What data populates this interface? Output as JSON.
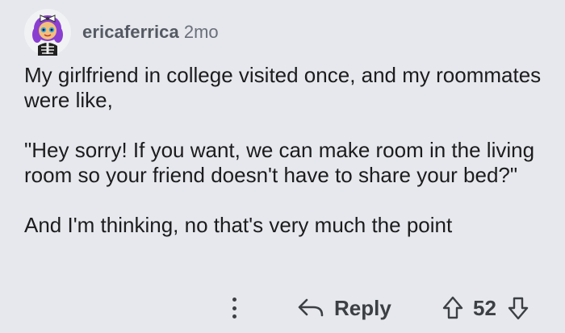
{
  "comment": {
    "username": "ericaferrica",
    "age": "2mo",
    "paragraphs": [
      "My girlfriend in college visited once, and my roommates were like,",
      "\"Hey sorry! If you want, we can make room in the living room so your friend doesn't have to share your bed?\"",
      "And I'm thinking, no that's very much the point"
    ]
  },
  "actions": {
    "more_icon": "vertical-dots-icon",
    "reply_icon": "reply-arrow-icon",
    "reply_label": "Reply",
    "upvote_icon": "upvote-arrow-icon",
    "vote_count": "52",
    "downvote_icon": "downvote-arrow-icon"
  },
  "colors": {
    "background": "#e6e8ee",
    "text": "#1c1c1c",
    "meta": "#555a62",
    "action": "#3c3f44"
  }
}
